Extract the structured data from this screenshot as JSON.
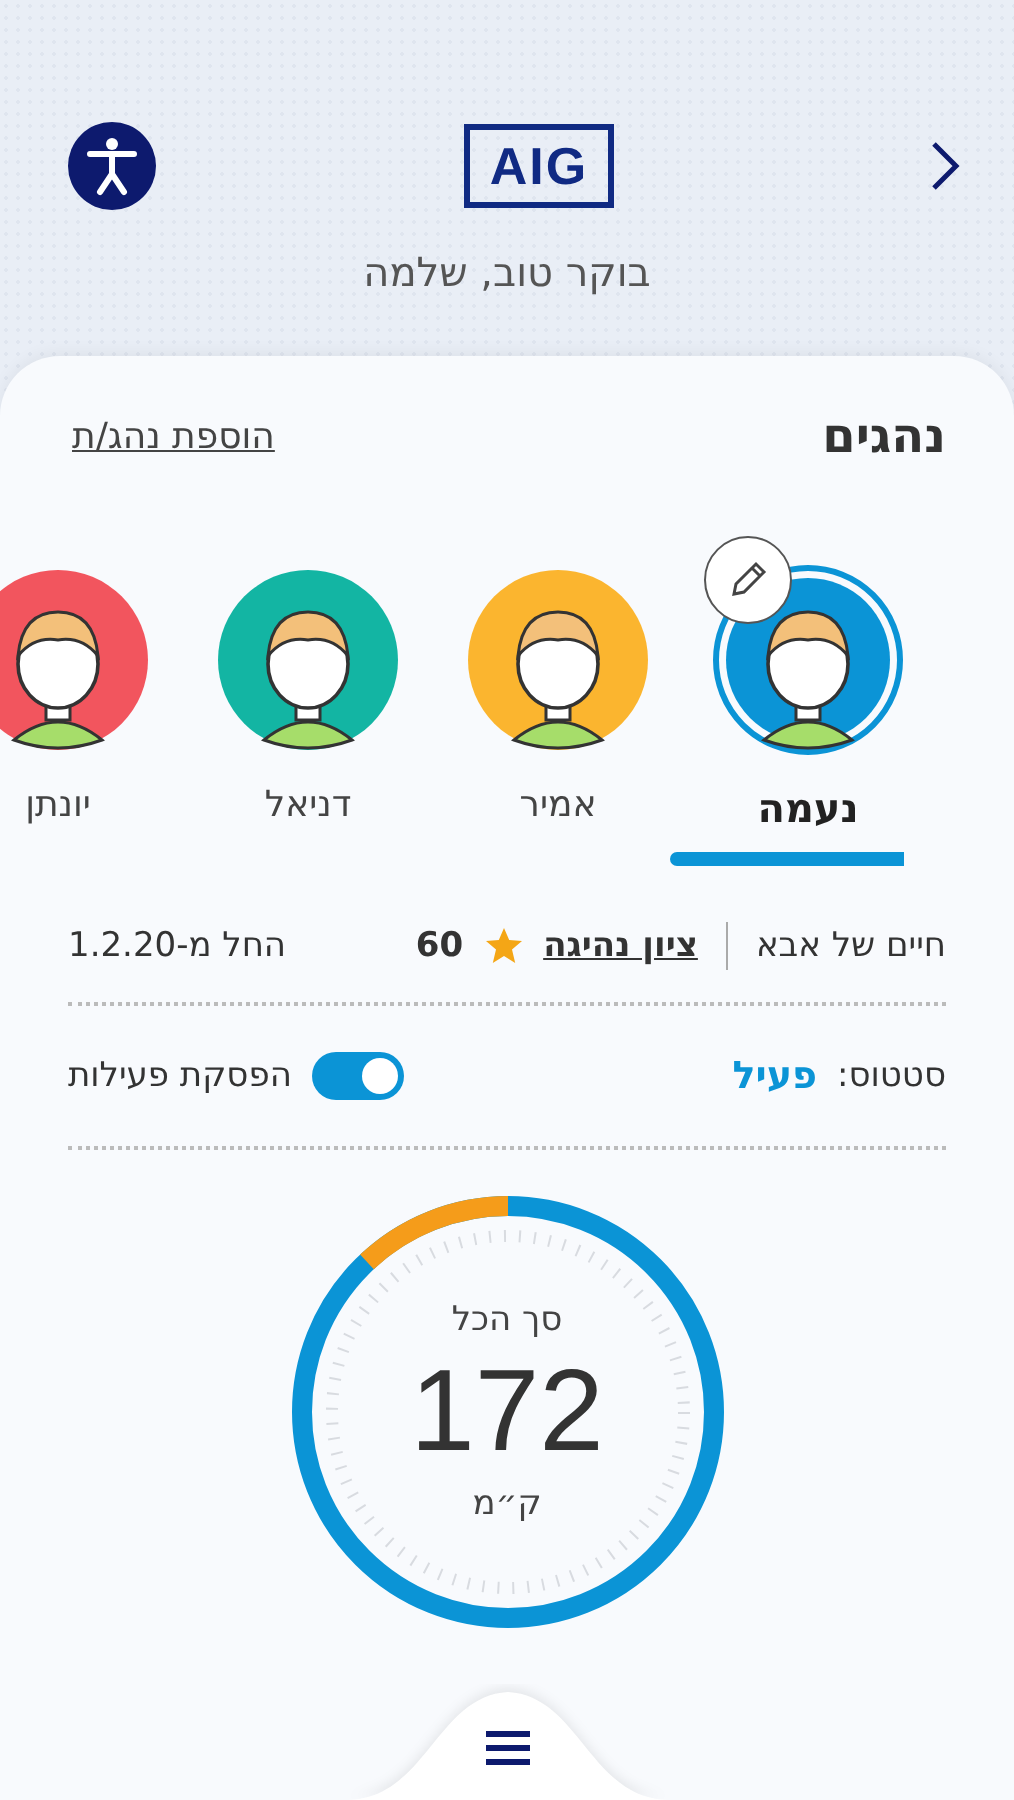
{
  "header": {
    "logo": "AIG",
    "greeting": "בוקר טוב, שלמה"
  },
  "drivers_section": {
    "title": "נהגים",
    "add_link": "הוספת נהג/ת",
    "drivers": [
      {
        "name": "נעמה",
        "selected": true,
        "color": "#0b94d6"
      },
      {
        "name": "אמיר",
        "selected": false,
        "color": "#fbb52f"
      },
      {
        "name": "דניאל",
        "selected": false,
        "color": "#13b5a3"
      },
      {
        "name": "יונתן",
        "selected": false,
        "color": "#f2555e"
      }
    ]
  },
  "info": {
    "policy": "חיים של אבא",
    "score_link": "ציון נהיגה",
    "score": "60",
    "start_date": "החל מ-1.2.20"
  },
  "status": {
    "label": "סטטוס:",
    "value": "פעיל",
    "toggle_label": "הפסקת פעילות",
    "toggle_on": true
  },
  "total": {
    "label": "סך הכל",
    "value": "172",
    "unit": "ק״מ",
    "level": 0.12
  }
}
